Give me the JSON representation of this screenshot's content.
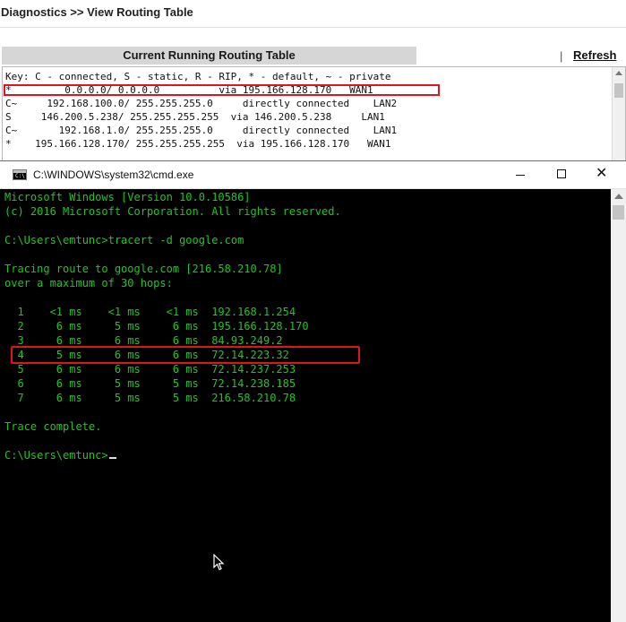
{
  "page": {
    "breadcrumb": "Diagnostics >> View Routing Table",
    "table_title": "Current Running Routing Table",
    "separator": "|",
    "refresh_label": "Refresh"
  },
  "routing": {
    "key_line": "Key: C - connected, S - static, R - RIP, * - default, ~ - private",
    "routes": [
      "*         0.0.0.0/ 0.0.0.0          via 195.166.128.170   WAN1",
      "C~     192.168.100.0/ 255.255.255.0     directly connected    LAN2",
      "S     146.200.5.238/ 255.255.255.255  via 146.200.5.238     LAN1",
      "C~       192.168.1.0/ 255.255.255.0     directly connected    LAN1",
      "*    195.166.128.170/ 255.255.255.255  via 195.166.128.170   WAN1"
    ]
  },
  "cmd": {
    "title": "C:\\WINDOWS\\system32\\cmd.exe",
    "icon_prompt": "C:\\",
    "close_glyph": "✕",
    "lines": [
      "Microsoft Windows [Version 10.0.10586]",
      "(c) 2016 Microsoft Corporation. All rights reserved.",
      "",
      "C:\\Users\\emtunc>tracert -d google.com",
      "",
      "Tracing route to google.com [216.58.210.78]",
      "over a maximum of 30 hops:",
      "",
      "  1    <1 ms    <1 ms    <1 ms  192.168.1.254",
      "  2     6 ms     5 ms     6 ms  195.166.128.170",
      "  3     6 ms     6 ms     6 ms  84.93.249.2",
      "  4     5 ms     6 ms     6 ms  72.14.223.32",
      "  5     6 ms     6 ms     6 ms  72.14.237.253",
      "  6     6 ms     5 ms     5 ms  72.14.238.185",
      "  7     6 ms     5 ms     5 ms  216.58.210.78",
      "",
      "Trace complete.",
      ""
    ],
    "prompt": "C:\\Users\\emtunc>"
  },
  "colors": {
    "console_text": "#1ec81e",
    "highlight": "#e0141c"
  }
}
